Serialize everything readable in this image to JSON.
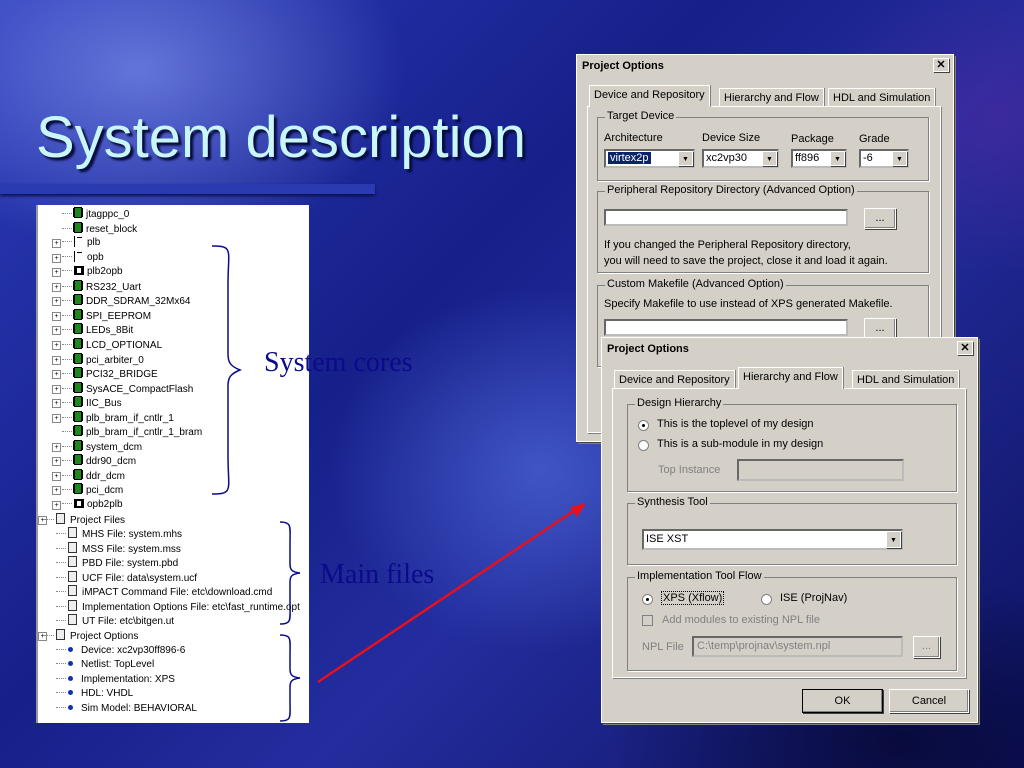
{
  "slide": {
    "title": "System description",
    "label_cores": "System cores",
    "label_files": "Main files"
  },
  "tree": {
    "cores": [
      {
        "name": "jtagppc_0",
        "icon": "chip-icon",
        "expand": false
      },
      {
        "name": "reset_block",
        "icon": "chip-icon",
        "expand": false
      },
      {
        "name": "plb",
        "icon": "bus-icon",
        "expand": true
      },
      {
        "name": "opb",
        "icon": "bus-icon",
        "expand": true
      },
      {
        "name": "plb2opb",
        "icon": "bridge-icon",
        "expand": true
      },
      {
        "name": "RS232_Uart",
        "icon": "chip-icon",
        "expand": true
      },
      {
        "name": "DDR_SDRAM_32Mx64",
        "icon": "chip-icon",
        "expand": true
      },
      {
        "name": "SPI_EEPROM",
        "icon": "chip-icon",
        "expand": true
      },
      {
        "name": "LEDs_8Bit",
        "icon": "chip-icon",
        "expand": true
      },
      {
        "name": "LCD_OPTIONAL",
        "icon": "chip-icon",
        "expand": true
      },
      {
        "name": "pci_arbiter_0",
        "icon": "chip-icon",
        "expand": true
      },
      {
        "name": "PCI32_BRIDGE",
        "icon": "chip-icon",
        "expand": true
      },
      {
        "name": "SysACE_CompactFlash",
        "icon": "chip-icon",
        "expand": true
      },
      {
        "name": "IIC_Bus",
        "icon": "chip-icon",
        "expand": true
      },
      {
        "name": "plb_bram_if_cntlr_1",
        "icon": "chip-icon",
        "expand": true
      },
      {
        "name": "plb_bram_if_cntlr_1_bram",
        "icon": "chip-icon",
        "expand": false
      },
      {
        "name": "system_dcm",
        "icon": "chip-icon",
        "expand": true
      },
      {
        "name": "ddr90_dcm",
        "icon": "chip-icon",
        "expand": true
      },
      {
        "name": "ddr_dcm",
        "icon": "chip-icon",
        "expand": true
      },
      {
        "name": "pci_dcm",
        "icon": "chip-icon",
        "expand": true
      },
      {
        "name": "opb2plb",
        "icon": "bridge-icon",
        "expand": true
      }
    ],
    "project_files_label": "Project Files",
    "files": [
      "MHS File: system.mhs",
      "MSS File: system.mss",
      "PBD File: system.pbd",
      "UCF File: data\\system.ucf",
      "iMPACT Command File: etc\\download.cmd",
      "Implementation Options File: etc\\fast_runtime.opt",
      "UT File: etc\\bitgen.ut"
    ],
    "project_options_label": "Project Options",
    "options": [
      "Device: xc2vp30ff896-6",
      "Netlist: TopLevel",
      "Implementation: XPS",
      "HDL: VHDL",
      "Sim Model: BEHAVIORAL"
    ]
  },
  "dialog1": {
    "title": "Project Options",
    "close": "✕",
    "tabs": [
      "Device and Repository",
      "Hierarchy and Flow",
      "HDL and Simulation"
    ],
    "target_device": {
      "legend": "Target Device",
      "arch_label": "Architecture",
      "arch_value": "virtex2p",
      "size_label": "Device Size",
      "size_value": "xc2vp30",
      "package_label": "Package",
      "package_value": "ff896",
      "grade_label": "Grade",
      "grade_value": "-6"
    },
    "peripheral": {
      "legend": "Peripheral Repository Directory (Advanced Option)",
      "value": "",
      "browse": "...",
      "note_line1": "If you changed the Peripheral Repository directory,",
      "note_line2": "you will need to save the project, close it and load it again."
    },
    "makefile": {
      "legend": "Custom Makefile (Advanced Option)",
      "note": "Specify Makefile to use instead of XPS generated Makefile.",
      "value": "",
      "browse": "..."
    }
  },
  "dialog2": {
    "title": "Project Options",
    "close": "✕",
    "tabs": [
      "Device and Repository",
      "Hierarchy and Flow",
      "HDL and Simulation"
    ],
    "hierarchy": {
      "legend": "Design Hierarchy",
      "opt_top": "This is the toplevel of my design",
      "opt_sub": "This is a sub-module in my design",
      "instance_label": "Top Instance",
      "instance_value": ""
    },
    "synthesis": {
      "legend": "Synthesis Tool",
      "value": "ISE XST"
    },
    "impl": {
      "legend": "Implementation Tool Flow",
      "opt_xps": "XPS (Xflow)",
      "opt_ise": "ISE (ProjNav)",
      "add_modules": "Add modules to existing NPL file",
      "npl_label": "NPL File",
      "npl_value": "C:\\temp\\projnav\\system.npl",
      "browse": "..."
    },
    "ok": "OK",
    "cancel": "Cancel"
  },
  "colors": {
    "title": "#c9f6f6",
    "labels": "#0a0a8a",
    "arrow": "#e8101a",
    "dialog_face": "#d4d0c8"
  }
}
